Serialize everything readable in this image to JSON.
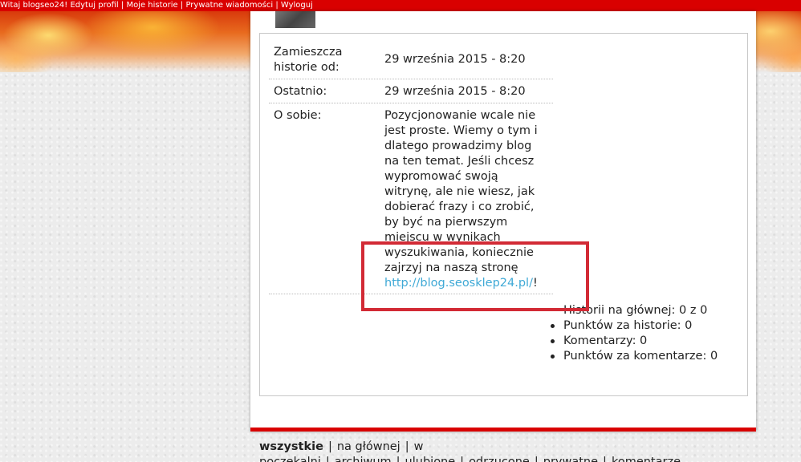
{
  "topbar": {
    "greeting": "Witaj blogseo24!",
    "links": [
      "Edytuj profil",
      "Moje historie",
      "Prywatne wiadomości",
      "Wyloguj"
    ],
    "separator": "|"
  },
  "profile": {
    "since_label": "Zamieszcza historie od:",
    "since_value": "29 września 2015 - 8:20",
    "last_label": "Ostatnio:",
    "last_value": "29 września 2015 - 8:20",
    "about_label": "O sobie:",
    "about_text": "Pozycjonowanie wcale nie jest proste. Wiemy o tym i dlatego prowadzimy blog na ten temat. Jeśli chcesz wypromować swoją witrynę, ale nie wiesz, jak dobierać frazy i co zrobić, by być na pierwszym miejscu w wynikach wyszukiwania, koniecznie zajrzyj na naszą stronę ",
    "about_link": "http://blog.seosklep24.pl/",
    "about_tail": "!"
  },
  "stats": [
    "Historii na głównej: 0 z 0",
    "Punktów za historie: 0",
    "Komentarzy: 0",
    "Punktów za komentarze: 0"
  ],
  "bottom_nav": {
    "items": [
      "wszystkie",
      "na głównej",
      "w poczekalni",
      "archiwum",
      "ulubione",
      "odrzucone",
      "prywatne",
      "komentarze"
    ],
    "active": "wszystkie",
    "separator": "|"
  },
  "colors": {
    "topbar": "#d90000",
    "link": "#3fa9d6",
    "highlight_box": "#d22a35"
  }
}
